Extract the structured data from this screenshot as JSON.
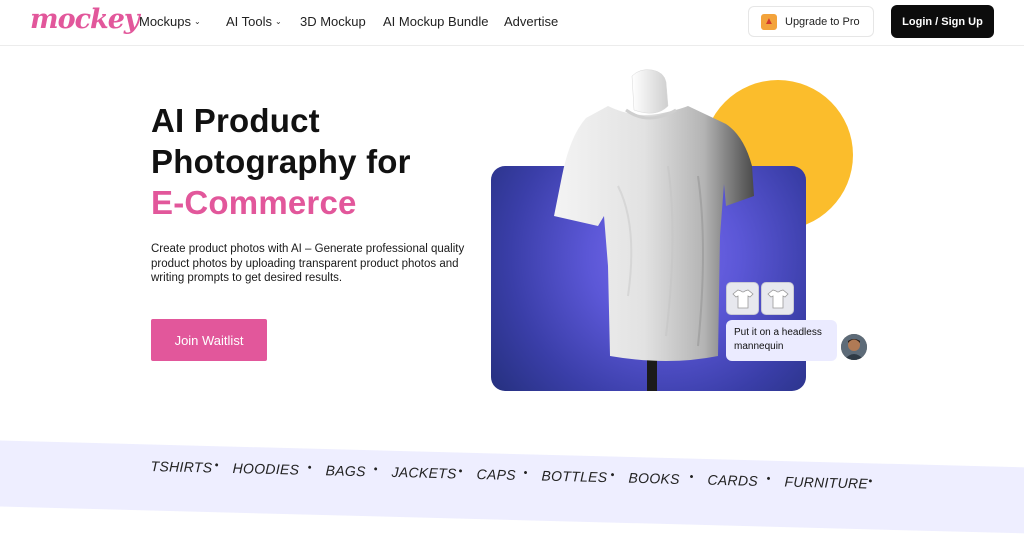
{
  "header": {
    "logo": "mockey",
    "nav": [
      {
        "label": "Mockups",
        "dropdown": true
      },
      {
        "label": "AI Tools",
        "dropdown": true
      },
      {
        "label": "3D Mockup",
        "dropdown": false
      },
      {
        "label": "AI Mockup Bundle",
        "dropdown": false
      },
      {
        "label": "Advertise",
        "dropdown": false
      }
    ],
    "upgrade_label": "Upgrade to Pro",
    "login_label": "Login / Sign Up"
  },
  "hero": {
    "title_line1": "AI Product",
    "title_line2": "Photography for",
    "title_highlight": "E-Commerce",
    "description": "Create product photos with AI – Generate professional quality product photos by uploading transparent product photos and writing prompts to get desired results.",
    "cta_label": "Join Waitlist"
  },
  "visual": {
    "prompt_text": "Put it on a headless mannequin"
  },
  "categories": [
    "TSHIRTS",
    "HOODIES",
    "BAGS",
    "JACKETS",
    "CAPS",
    "BOTTLES",
    "BOOKS",
    "CARDS",
    "FURNITURE"
  ],
  "colors": {
    "brand_pink": "#e2579b",
    "accent_yellow": "#fbbd2c",
    "card_blue": "#5b57d6",
    "ribbon_bg": "#eeeeff"
  }
}
